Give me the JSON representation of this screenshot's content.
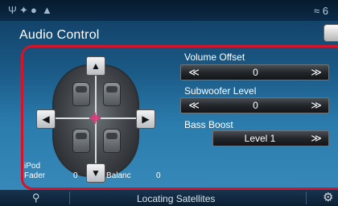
{
  "title_bar": {
    "title": "Audio Control"
  },
  "status_bar": {
    "icons": [
      "antenna-icon",
      "bluetooth-icon",
      "phone-icon",
      "warning-icon",
      "wifi-icon"
    ],
    "signal_value": "6"
  },
  "seat_map": {
    "source_label": "iPod",
    "fader_label": "Fader",
    "fader_value": "0",
    "balance_label": "Balanc",
    "balance_value": "0",
    "arrows": {
      "up": "▲",
      "down": "▼",
      "left": "◀",
      "right": "▶"
    }
  },
  "controls": {
    "volume_offset": {
      "label": "Volume Offset",
      "value": "0",
      "dec": "≪",
      "inc": "≫"
    },
    "subwoofer_level": {
      "label": "Subwoofer Level",
      "value": "0",
      "dec": "≪",
      "inc": "≫"
    },
    "bass_boost": {
      "label": "Bass Boost",
      "value": "Level 1",
      "inc": "≫"
    }
  },
  "bottom_bar": {
    "status": "Locating Satellites"
  },
  "colors": {
    "highlight_border": "#d4142a",
    "listening_marker": "#e0387c",
    "background": "#2a7cad"
  }
}
